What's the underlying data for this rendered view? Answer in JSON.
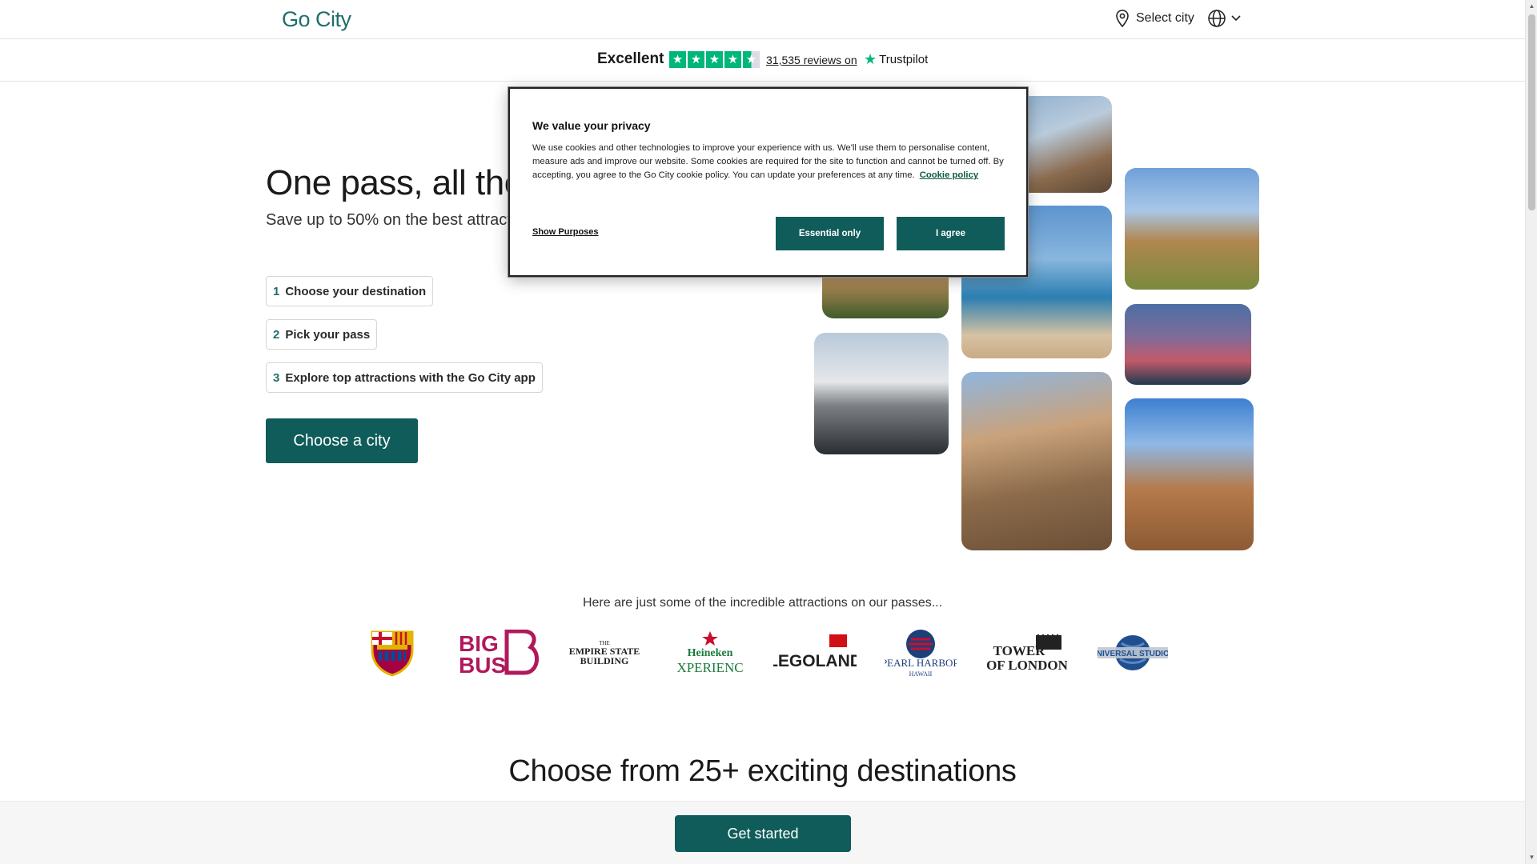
{
  "header": {
    "logo": "Go City",
    "select_city_label": "Select city"
  },
  "trustbar": {
    "rating_word": "Excellent",
    "reviews_text": "31,535 reviews on",
    "trustpilot_label": "Trustpilot"
  },
  "hero": {
    "title": "One pass, all the",
    "subtitle": "Save up to 50% on the best attract",
    "steps": [
      {
        "num": "1",
        "label": "Choose your destination"
      },
      {
        "num": "2",
        "label": "Pick your pass"
      },
      {
        "num": "3",
        "label": "Explore top attractions with the Go City app"
      }
    ],
    "cta_label": "Choose a city"
  },
  "consent": {
    "title": "We value your privacy",
    "body": "We use cookies and other technologies to improve your experience with us. We'll use them to personalise content, measure ads and improve our website. Some cookies are required for the site to function and cannot be turned off. By accepting, you agree to the Go City cookie policy. You can update your preferences at any time.",
    "policy_link": "Cookie policy",
    "show_purposes": "Show Purposes",
    "essential_only": "Essential only",
    "agree": "I agree"
  },
  "attractions": {
    "heading": "Here are just some of the incredible attractions on our passes...",
    "logos": [
      {
        "name": "FCB"
      },
      {
        "name": "BIG BUS"
      },
      {
        "name": "THE EMPIRE STATE BUILDING"
      },
      {
        "name": "Heineken EXPERIENCE"
      },
      {
        "name": "LEGOLAND"
      },
      {
        "name": "PEARL HARBOR HAWAII"
      },
      {
        "name": "TOWER OF LONDON"
      },
      {
        "name": "UNIVERSAL STUDIOS HOLLYWOOD"
      }
    ]
  },
  "destinations": {
    "title": "Choose from 25+ exciting destinations"
  },
  "sticky": {
    "get_started": "Get started"
  },
  "colors": {
    "brand": "#0f5c5a",
    "trustpilot_green": "#00b67a"
  }
}
